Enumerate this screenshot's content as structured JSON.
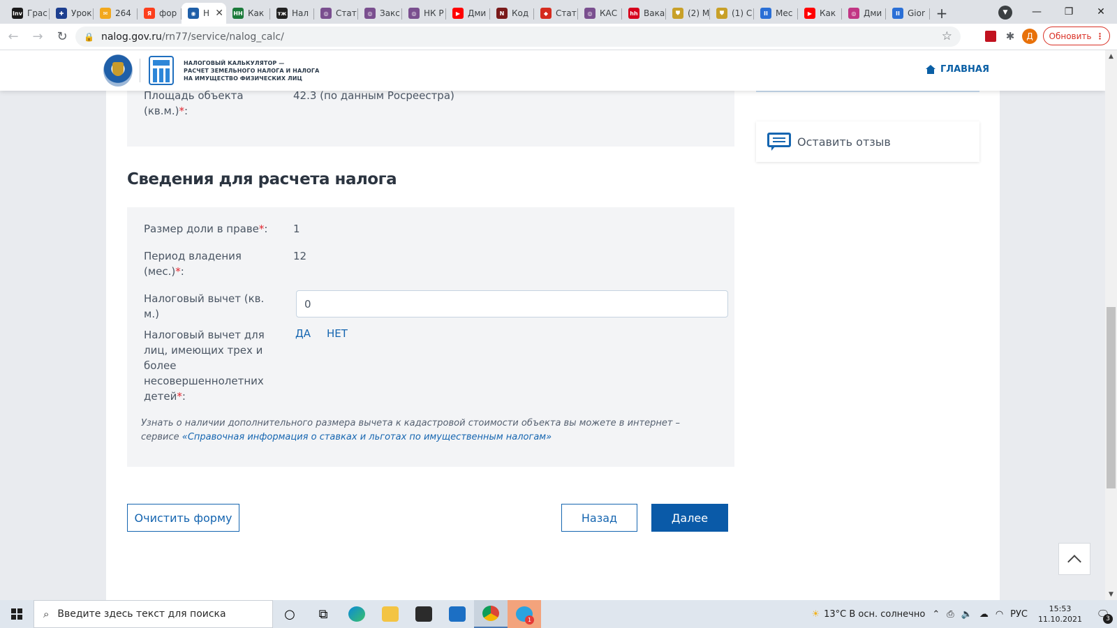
{
  "browser": {
    "tabs": [
      {
        "title": "Грас",
        "icon": "investing-icon",
        "color": "#1a1a1a",
        "glyph": "Inv"
      },
      {
        "title": "Урок",
        "icon": "uk-flag-icon",
        "color": "#1d3f8f",
        "glyph": "✚"
      },
      {
        "title": "264",
        "icon": "mail-icon",
        "color": "#f2a81d",
        "glyph": "✉"
      },
      {
        "title": "фор",
        "icon": "yandex-icon",
        "color": "#fc3f1d",
        "glyph": "Я"
      },
      {
        "title": "Н",
        "icon": "nalog-icon",
        "color": "#1f5fa8",
        "glyph": "◉"
      },
      {
        "title": "Как",
        "icon": "hh-news-icon",
        "color": "#1b7a3a",
        "glyph": "НН"
      },
      {
        "title": "Нал",
        "icon": "tj-icon",
        "color": "#222222",
        "glyph": "тж"
      },
      {
        "title": "Стат",
        "icon": "consultant-icon",
        "color": "#7a4f8f",
        "glyph": "◎"
      },
      {
        "title": "Закс",
        "icon": "consultant-icon",
        "color": "#7a4f8f",
        "glyph": "◎"
      },
      {
        "title": "НК Р",
        "icon": "consultant-icon",
        "color": "#7a4f8f",
        "glyph": "◎"
      },
      {
        "title": "Дми",
        "icon": "youtube-icon",
        "color": "#ff0000",
        "glyph": "▶"
      },
      {
        "title": "Код",
        "icon": "kodeks-icon",
        "color": "#7a1a1a",
        "glyph": "N"
      },
      {
        "title": "Стат",
        "icon": "ru-flag-icon",
        "color": "#d52b1e",
        "glyph": "◆"
      },
      {
        "title": "КАС",
        "icon": "consultant-icon",
        "color": "#7a4f8f",
        "glyph": "◎"
      },
      {
        "title": "Вака",
        "icon": "hh-icon",
        "color": "#d6001c",
        "glyph": "hh"
      },
      {
        "title": "(2) M",
        "icon": "shield-icon",
        "color": "#c8a028",
        "glyph": "⛊"
      },
      {
        "title": "(1) C",
        "icon": "shield-icon",
        "color": "#c8a028",
        "glyph": "⛊"
      },
      {
        "title": "Мес",
        "icon": "pause-icon",
        "color": "#2a6fd6",
        "glyph": "II"
      },
      {
        "title": "Как",
        "icon": "youtube-icon",
        "color": "#ff0000",
        "glyph": "▶"
      },
      {
        "title": "Дми",
        "icon": "instagram-icon",
        "color": "#c13584",
        "glyph": "◎"
      },
      {
        "title": "Gior",
        "icon": "pause-icon",
        "color": "#2a6fd6",
        "glyph": "II"
      }
    ],
    "url_host": "nalog.gov.ru",
    "url_path": "/rn77/service/nalog_calc/",
    "update_label": "Обновить",
    "profile_letter": "Д"
  },
  "header": {
    "logo_text": [
      "НАЛОГОВЫЙ КАЛЬКУЛЯТОР —",
      "РАСЧЕТ ЗЕМЕЛЬНОГО НАЛОГА И НАЛОГА",
      "НА ИМУЩЕСТВО ФИЗИЧЕСКИХ ЛИЦ"
    ],
    "home_label": "ГЛАВНАЯ"
  },
  "object": {
    "area_label": "Площадь объекта",
    "area_label_2": "(кв.м.)",
    "area_value": "42.3 (по данным Росреестра)"
  },
  "section": {
    "title": "Сведения для расчета налога",
    "share_label": "Размер доли в праве",
    "share_value": "1",
    "period_label": "Период владения",
    "period_label_2": "(мес.)",
    "period_value": "12",
    "deduction_label": "Налоговый вычет (кв.",
    "deduction_label_2": "м.)",
    "deduction_value": "0",
    "children_label_lines": [
      "Налоговый вычет для",
      "лиц, имеющих трех и",
      "более",
      "несовершеннолетних"
    ],
    "children_label_last": "детей",
    "option_yes": "ДА",
    "option_no": "НЕТ",
    "required_mark": "*",
    "colon": ":",
    "hint_text": "Узнать о наличии дополнительного размера вычета к кадастровой стоимости объекта вы можете в интернет –",
    "hint_prefix": "сервисе ",
    "hint_link": "«Справочная информация о ставках и льготах по имущественным налогам»"
  },
  "actions": {
    "clear_label": "Очистить форму",
    "back_label": "Назад",
    "next_label": "Далее"
  },
  "sidebar": {
    "feedback_label": "Оставить отзыв"
  },
  "taskbar": {
    "search_placeholder": "Введите здесь текст для поиска",
    "weather": "13°C  В осн. солнечно",
    "lang": "РУС",
    "time": "15:53",
    "date": "11.10.2021",
    "notifications": "3",
    "telegram_badge": "1"
  },
  "colors": {
    "accent": "#0a5aa8",
    "link": "#1565b0",
    "required": "#e3262f"
  }
}
